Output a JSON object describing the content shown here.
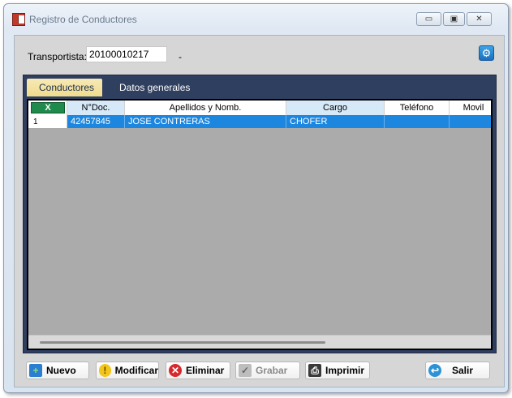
{
  "window": {
    "title": "Registro de Conductores"
  },
  "filter": {
    "label": "Transportista:",
    "value": "20100010217",
    "description": "-"
  },
  "tabs": [
    {
      "label": "Conductores",
      "active": true
    },
    {
      "label": "Datos generales",
      "active": false
    }
  ],
  "grid": {
    "excel_label": "X",
    "columns": [
      "N°Doc.",
      "Apellidos y Nomb.",
      "Cargo",
      "Teléfono",
      "Movil"
    ],
    "rows": [
      {
        "num": "1",
        "doc": "42457845",
        "name": "JOSE CONTRERAS",
        "cargo": "CHOFER",
        "telefono": "",
        "movil": ""
      }
    ]
  },
  "buttons": {
    "nuevo": "Nuevo",
    "modificar": "Modificar",
    "eliminar": "Eliminar",
    "grabar": "Grabar",
    "imprimir": "Imprimir",
    "salir": "Salir"
  },
  "colors": {
    "selection": "#1d86de",
    "tab_strip": "#2f3f5f",
    "active_tab": "#f0dc8d",
    "excel_green": "#1e8a4c"
  }
}
